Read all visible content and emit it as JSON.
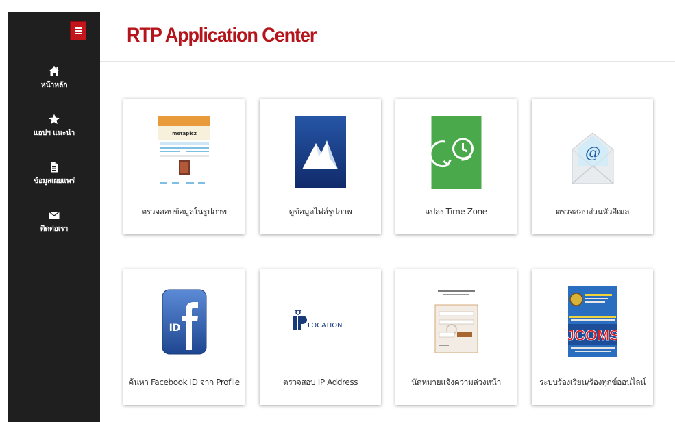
{
  "app": {
    "title": "RTP Application Center"
  },
  "sidebar": {
    "toggle_icon": "hamburger-icon",
    "items": [
      {
        "label": "หน้าหลัก",
        "icon": "home-icon"
      },
      {
        "label": "แอปฯ แนะนำ",
        "icon": "star-icon"
      },
      {
        "label": "ข้อมูลเผยแพร่",
        "icon": "document-icon"
      },
      {
        "label": "ติดต่อเรา",
        "icon": "envelope-icon"
      }
    ]
  },
  "cards": [
    {
      "label": "ตรวจสอบข้อมูลในรูปภาพ",
      "icon": "metapicz-screenshot",
      "thumb_text": "metapicz"
    },
    {
      "label": "ดูข้อมูลไฟล์รูปภาพ",
      "icon": "mountain-photo-icon"
    },
    {
      "label": "แปลง Time Zone",
      "icon": "timezone-clock-icon"
    },
    {
      "label": "ตรวจสอบส่วนหัวอีเมล",
      "icon": "email-envelope-icon",
      "thumb_text": "@"
    },
    {
      "label": "ค้นหา Facebook ID จาก Profile",
      "icon": "facebook-id-icon",
      "thumb_text": "ID"
    },
    {
      "label": "ตรวจสอบ IP Address",
      "icon": "ip-location-logo",
      "thumb_text": "LOCATION"
    },
    {
      "label": "นัดหมายแจ้งความล่วงหน้า",
      "icon": "appointment-form-screenshot"
    },
    {
      "label": "ระบบร้องเรียน/ร้องทุกข์ออนไลน์",
      "icon": "jcoms-logo",
      "thumb_text": "JCOMS"
    }
  ],
  "colors": {
    "sidebar_bg": "#1f1f1f",
    "accent_red": "#c3161c",
    "title_red": "#b5141a",
    "timezone_green": "#4aa94b",
    "facebook_blue": "#2f5ea8",
    "photo_blue": "#1c3f88",
    "jcoms_blue": "#2a6fbf"
  }
}
